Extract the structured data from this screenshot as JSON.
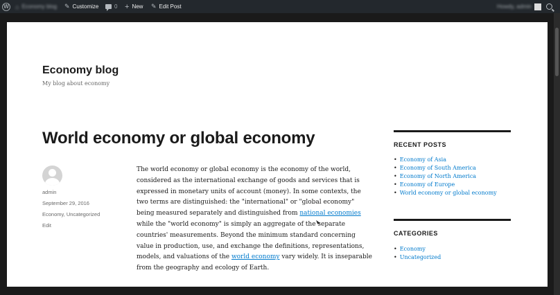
{
  "admin_bar": {
    "site_name": "Economy blog",
    "customize_label": "Customize",
    "comments_count": "0",
    "new_label": "New",
    "edit_post_label": "Edit Post",
    "account_label": "Howdy, admin"
  },
  "site": {
    "title": "Economy blog",
    "description": "My blog about economy"
  },
  "post": {
    "title": "World economy or global economy",
    "author": "admin",
    "date": "September 29, 2016",
    "categories": "Economy, Uncategorized",
    "edit_label": "Edit",
    "lines": [
      "The world economy or global economy is the economy of the world,",
      "considered as the international exchange of goods and services that is",
      "expressed in monetary units of account (money). In some contexts, the",
      "two terms are distinguished: the \"international\" or \"global economy\"",
      "being measured separately and distinguished from ",
      "while the \"world economy\" is simply an aggregate of the separate",
      "countries' measurements. Beyond the minimum standard concerning",
      "value in production, use, and exchange the definitions, representations,",
      "models, and valuations of the ",
      "from the geography and ecology of Earth."
    ],
    "link_national": "national economies",
    "link_world": "world economy",
    "after_world_link": " vary widely. It is inseparable"
  },
  "sidebar": {
    "recent_posts_title": "RECENT POSTS",
    "recent_posts": [
      "Economy of Asia",
      "Economy of South America",
      "Economy of North America",
      "Economy of Europe",
      "World economy or global economy"
    ],
    "categories_title": "CATEGORIES",
    "categories": [
      "Economy",
      "Uncategorized"
    ]
  },
  "colors": {
    "admin_bar_bg": "#23282d",
    "link": "#007acc",
    "text": "#1a1a1a"
  }
}
